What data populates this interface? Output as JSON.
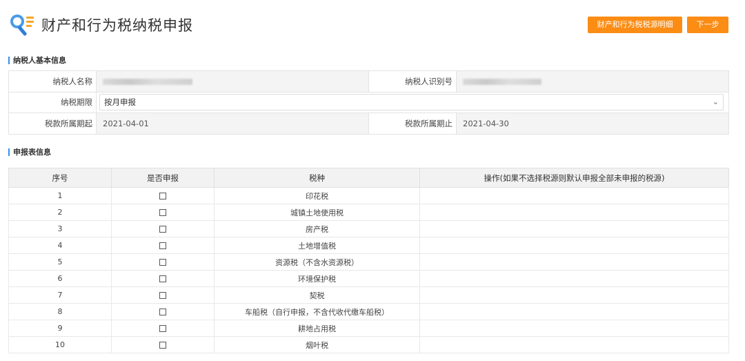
{
  "header": {
    "title": "财产和行为税纳税申报",
    "detail_button": "财产和行为税税源明细",
    "next_button": "下一步"
  },
  "basic_info": {
    "section_title": "纳税人基本信息",
    "taxpayer_name_label": "纳税人名称",
    "taxpayer_id_label": "纳税人识别号",
    "period_label": "纳税期限",
    "period_value": "按月申报",
    "start_label": "税款所属期起",
    "start_value": "2021-04-01",
    "end_label": "税款所属期止",
    "end_value": "2021-04-30"
  },
  "declaration": {
    "section_title": "申报表信息",
    "columns": [
      "序号",
      "是否申报",
      "税种",
      "操作(如果不选择税源则默认申报全部未申报的税源)"
    ],
    "rows": [
      {
        "no": "1",
        "tax": "印花税",
        "checked": false
      },
      {
        "no": "2",
        "tax": "城镇土地使用税",
        "checked": false
      },
      {
        "no": "3",
        "tax": "房产税",
        "checked": false
      },
      {
        "no": "4",
        "tax": "土地增值税",
        "checked": false
      },
      {
        "no": "5",
        "tax": "资源税（不含水资源税）",
        "checked": false
      },
      {
        "no": "6",
        "tax": "环境保护税",
        "checked": false
      },
      {
        "no": "7",
        "tax": "契税",
        "checked": false
      },
      {
        "no": "8",
        "tax": "车船税（自行申报，不含代收代缴车船税）",
        "checked": false
      },
      {
        "no": "9",
        "tax": "耕地占用税",
        "checked": false
      },
      {
        "no": "10",
        "tax": "烟叶税",
        "checked": false
      }
    ]
  }
}
